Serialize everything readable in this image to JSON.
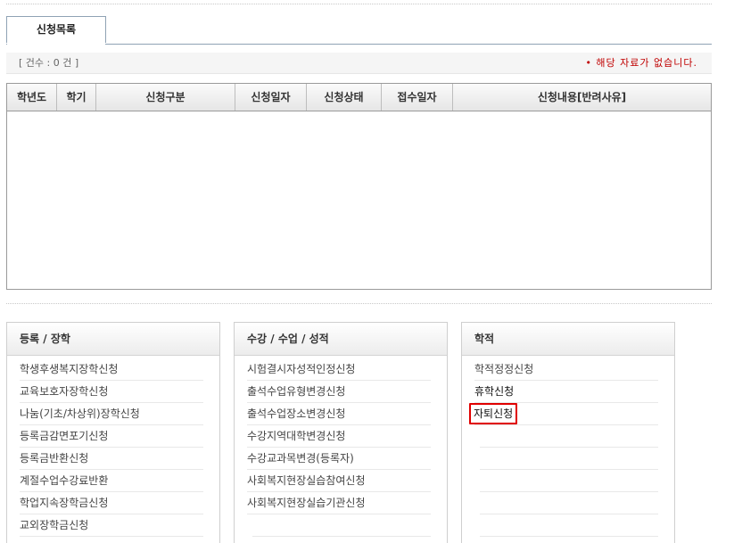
{
  "tabs": [
    {
      "label": "신청목록"
    }
  ],
  "summary": {
    "count_text": "[ 건수 : 0 건 ]",
    "no_data_text": "• 해당 자료가 없습니다."
  },
  "table": {
    "columns": [
      "학년도",
      "학기",
      "신청구분",
      "신청일자",
      "신청상태",
      "접수일자",
      "신청내용[반려사유]"
    ],
    "rows": []
  },
  "panels": {
    "registration": {
      "title": "등록 / 장학",
      "items": [
        "학생후생복지장학신청",
        "교육보호자장학신청",
        "나눔(기초/차상위)장학신청",
        "등록금감면포기신청",
        "등록금반환신청",
        "계절수업수강료반환",
        "학업지속장학금신청",
        "교외장학금신청"
      ]
    },
    "courses": {
      "title": "수강 / 수업 / 성적",
      "items": [
        "시험결시자성적인정신청",
        "출석수업유형변경신청",
        "출석수업장소변경신청",
        "수강지역대학변경신청",
        "수강교과목변경(등록자)",
        "사회복지현장실습참여신청",
        "사회복지현장실습기관신청"
      ]
    },
    "academic": {
      "title": "학적",
      "items": [
        "학적정정신청",
        "휴학신청",
        "자퇴신청"
      ],
      "highlighted": "자퇴신청"
    }
  },
  "colors": {
    "highlight": "#e00000",
    "alert_text": "#c00000"
  }
}
